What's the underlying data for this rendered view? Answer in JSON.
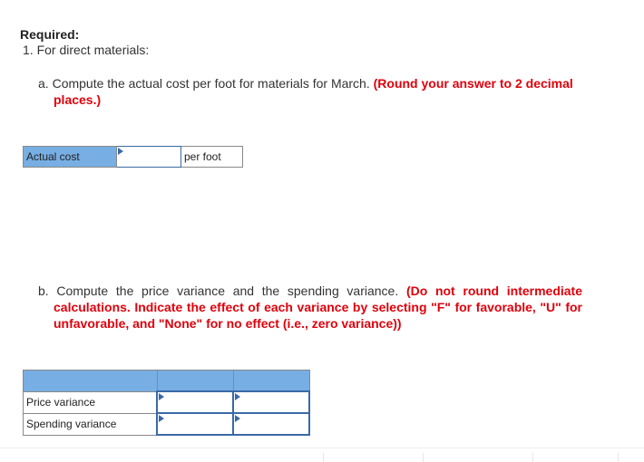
{
  "required_label": "Required:",
  "question_1": "1. For direct materials:",
  "part_a": {
    "marker": "a.",
    "text": "Compute the actual cost per foot for materials for March.",
    "instruction": "(Round your answer to 2 decimal places.)",
    "row_label": "Actual cost",
    "input_value": "",
    "unit": "per foot"
  },
  "part_b": {
    "marker": "b.",
    "text": "Compute the price variance and the spending variance.",
    "instruction": "(Do not round intermediate calculations. Indicate the effect of each variance by selecting \"F\" for favorable, \"U\" for unfavorable, and \"None\" for no effect (i.e., zero variance))",
    "header": [
      "",
      "",
      ""
    ],
    "rows": [
      {
        "label": "Price variance",
        "amount": "",
        "effect": ""
      },
      {
        "label": "Spending variance",
        "amount": "",
        "effect": ""
      }
    ]
  },
  "colors": {
    "header_blue": "#77aee3",
    "input_border": "#3a69a6",
    "instruction_red": "#e0000b"
  }
}
